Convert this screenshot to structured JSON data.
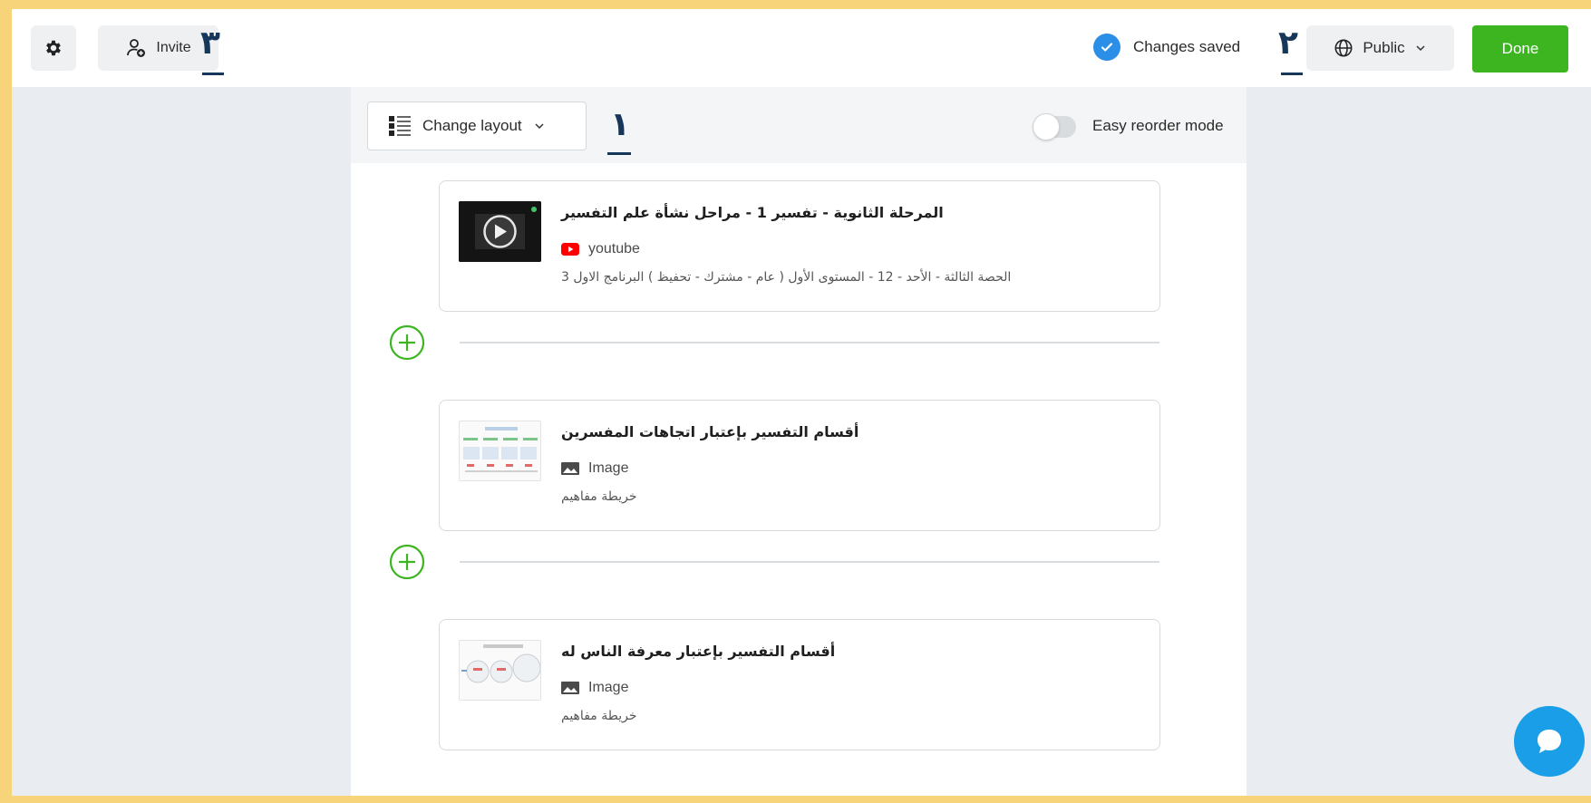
{
  "topbar": {
    "invite_label": "Invite",
    "saved_label": "Changes saved",
    "visibility_label": "Public",
    "done_label": "Done"
  },
  "annotations": {
    "invite_marker": "٣",
    "visibility_marker": "٢",
    "layout_marker": "١"
  },
  "toolbar": {
    "layout_label": "Change layout",
    "reorder_label": "Easy reorder mode"
  },
  "posts": [
    {
      "title": "المرحلة الثانوية - تفسير 1 - مراحل نشأة علم التفسير",
      "source": "youtube",
      "description": "الحصة الثالثة - الأحد - 12 - المستوى الأول ( عام - مشترك - تحفيظ ) البرنامج الاول 3",
      "icon": "youtube-icon"
    },
    {
      "title": "أقسام التفسير بإعتبار اتجاهات المفسرين",
      "source": "Image",
      "description": "خريطة مفاهيم",
      "icon": "image-icon"
    },
    {
      "title": "أقسام التفسير بإعتبار معرفة الناس له",
      "source": "Image",
      "description": "خريطة مفاهيم",
      "icon": "image-icon"
    }
  ],
  "colors": {
    "accent_green": "#3cb521",
    "saved_blue": "#2b8fe8",
    "annotation_navy": "#17375a",
    "chat_blue": "#1a9ee8",
    "frame_yellow": "#f7d37a"
  }
}
